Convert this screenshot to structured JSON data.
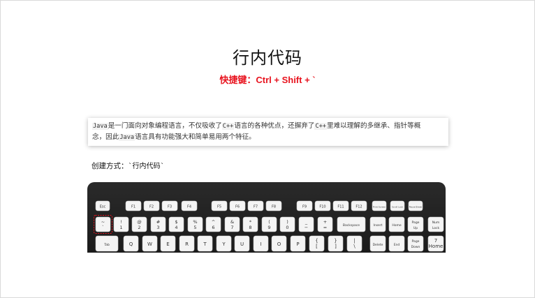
{
  "slide": {
    "title": "行内代码",
    "shortcut": "快捷键：Ctrl + Shift + `"
  },
  "paragraph": {
    "line1": [
      {
        "t": "Java",
        "code": true
      },
      {
        "t": "是一门面向对象编程语言，不仅吸收了",
        "code": false
      },
      {
        "t": "C++",
        "code": true
      },
      {
        "t": "语言的各种优点，还摒弃了",
        "code": false
      },
      {
        "t": "C++",
        "code": true
      },
      {
        "t": "里难以理解的多继承、指针等概",
        "code": false
      }
    ],
    "line2": [
      {
        "t": "念，因此",
        "code": false
      },
      {
        "t": "Java",
        "code": true
      },
      {
        "t": "语言具有功能强大和简单易用两个特征。",
        "code": false
      }
    ]
  },
  "method": {
    "label": "创建方式：",
    "code": "`行内代码`"
  },
  "keyboard": {
    "colors": {
      "body": "#1e1e1e",
      "key": "#f4f4f4",
      "highlight": "#e8131e"
    },
    "row_fn": [
      "Esc",
      "F1",
      "F2",
      "F3",
      "F4",
      "F5",
      "F6",
      "F7",
      "F8",
      "F9",
      "F10",
      "F11",
      "F12",
      "Print Screen",
      "Scroll Lock",
      "Pause Break"
    ],
    "row_num": [
      {
        "top": "~",
        "bottom": "`"
      },
      {
        "top": "!",
        "bottom": "1"
      },
      {
        "top": "@",
        "bottom": "2"
      },
      {
        "top": "#",
        "bottom": "3"
      },
      {
        "top": "$",
        "bottom": "4"
      },
      {
        "top": "%",
        "bottom": "5"
      },
      {
        "top": "^",
        "bottom": "6"
      },
      {
        "top": "&",
        "bottom": "7"
      },
      {
        "top": "*",
        "bottom": "8"
      },
      {
        "top": "(",
        "bottom": "9"
      },
      {
        "top": ")",
        "bottom": "0"
      },
      {
        "top": "_",
        "bottom": "−"
      },
      {
        "top": "+",
        "bottom": "="
      },
      {
        "top": "Backspace",
        "bottom": ""
      },
      {
        "top": "Insert",
        "bottom": ""
      },
      {
        "top": "Home",
        "bottom": ""
      },
      {
        "top": "Page",
        "bottom": "Up"
      },
      {
        "top": "Num",
        "bottom": "Lock"
      }
    ],
    "row_q": [
      {
        "top": "Tab",
        "bottom": ""
      },
      {
        "top": "Q",
        "bottom": ""
      },
      {
        "top": "W",
        "bottom": ""
      },
      {
        "top": "E",
        "bottom": ""
      },
      {
        "top": "R",
        "bottom": ""
      },
      {
        "top": "T",
        "bottom": ""
      },
      {
        "top": "Y",
        "bottom": ""
      },
      {
        "top": "U",
        "bottom": ""
      },
      {
        "top": "I",
        "bottom": ""
      },
      {
        "top": "O",
        "bottom": ""
      },
      {
        "top": "P",
        "bottom": ""
      },
      {
        "top": "{",
        "bottom": "["
      },
      {
        "top": "}",
        "bottom": "]"
      },
      {
        "top": "|",
        "bottom": "\\"
      },
      {
        "top": "Delete",
        "bottom": ""
      },
      {
        "top": "End",
        "bottom": ""
      },
      {
        "top": "Page",
        "bottom": "Down"
      },
      {
        "top": "7",
        "bottom": "Home"
      }
    ]
  }
}
